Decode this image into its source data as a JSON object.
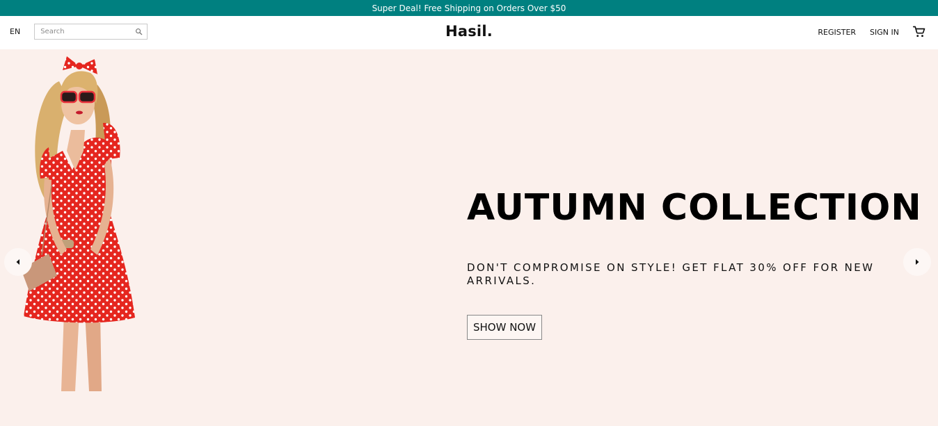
{
  "announcement": {
    "text": "Super Deal! Free Shipping on Orders Over $50"
  },
  "header": {
    "language": "EN",
    "search_placeholder": "Search",
    "logo": "Hasil.",
    "register_label": "REGISTER",
    "signin_label": "SIGN IN"
  },
  "icons": {
    "search": "search-icon",
    "cart": "cart-icon",
    "prev": "chevron-left-icon",
    "next": "chevron-right-icon"
  },
  "hero": {
    "title": "AUTUMN COLLECTION",
    "subtitle": "DON'T COMPROMISE ON STYLE! GET FLAT 30% OFF FOR NEW ARRIVALS.",
    "button_label": "SHOW NOW"
  },
  "colors": {
    "announcement_bg": "#008080",
    "hero_bg": "#fbf0ec"
  }
}
